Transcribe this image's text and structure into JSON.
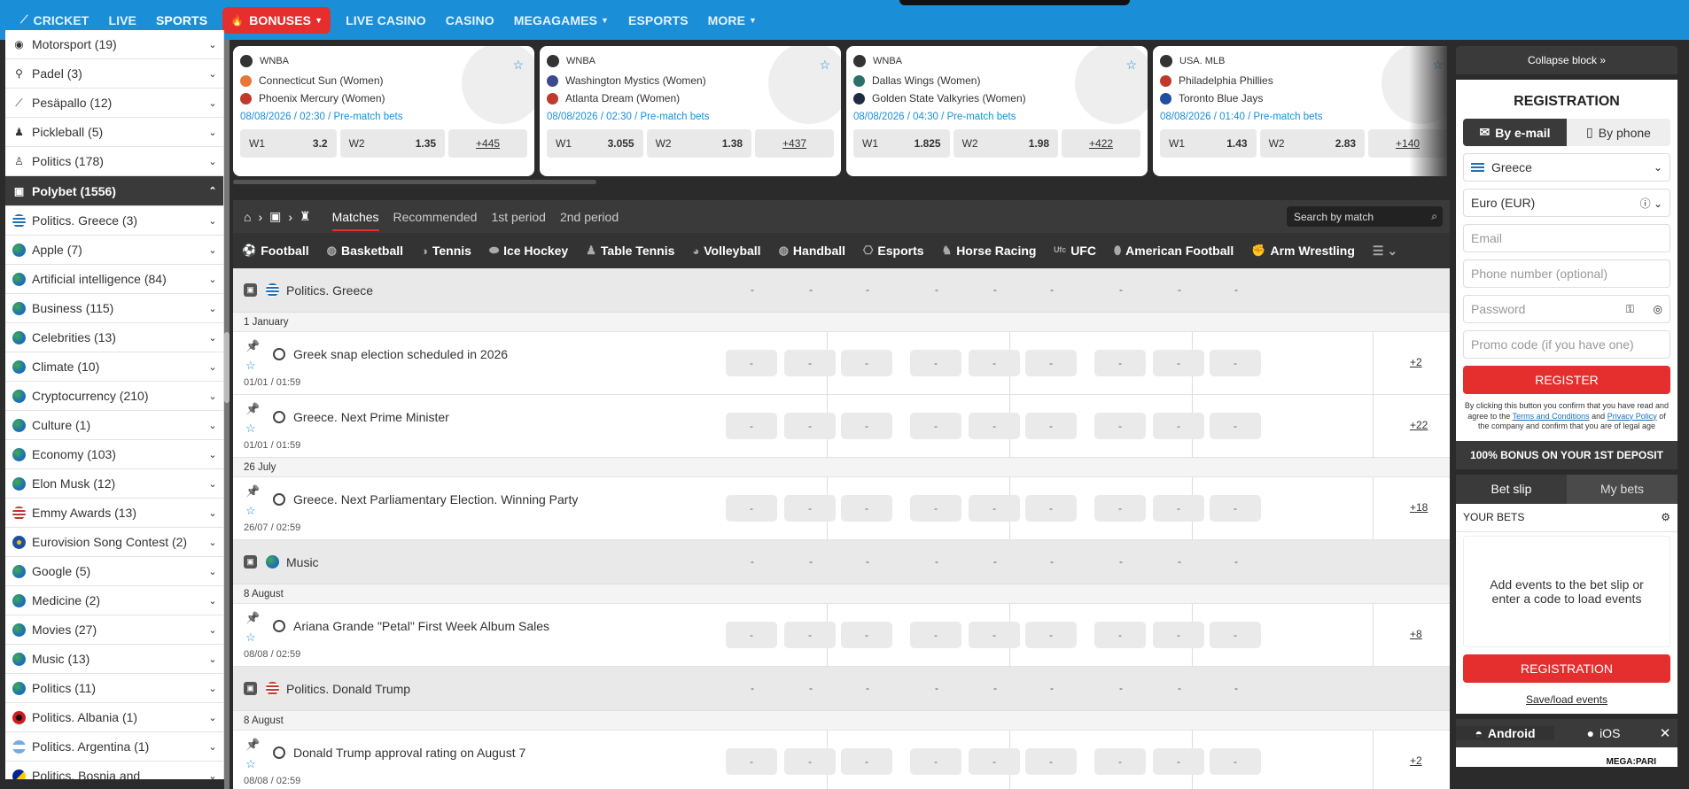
{
  "nav": {
    "items": [
      {
        "label": "CRICKET",
        "icon": "cricket-bat-icon"
      },
      {
        "label": "LIVE"
      },
      {
        "label": "SPORTS",
        "active": true
      },
      {
        "label": "BONUSES",
        "icon": "fire-icon",
        "dropdown": true,
        "style": "bonus"
      },
      {
        "label": "LIVE CASINO"
      },
      {
        "label": "CASINO"
      },
      {
        "label": "MEGAGAMES",
        "dropdown": true
      },
      {
        "label": "ESPORTS"
      },
      {
        "label": "MORE",
        "dropdown": true
      }
    ],
    "brand_color": "#1a8fd8"
  },
  "sidebar": {
    "items": [
      {
        "label": "Motorsport (19)",
        "icon": "motorsport-icon"
      },
      {
        "label": "Padel (3)",
        "icon": "padel-icon"
      },
      {
        "label": "Pesäpallo (12)",
        "icon": "pesapallo-icon"
      },
      {
        "label": "Pickleball (5)",
        "icon": "pickleball-icon"
      },
      {
        "label": "Politics (178)",
        "icon": "politics-icon"
      },
      {
        "label": "Polybet (1556)",
        "icon": "polybet-icon",
        "header": true
      },
      {
        "label": "Politics. Greece (3)",
        "icon": "greece-flag-icon"
      },
      {
        "label": "Apple (7)",
        "icon": "globe-icon"
      },
      {
        "label": "Artificial intelligence (84)",
        "icon": "globe-icon"
      },
      {
        "label": "Business (115)",
        "icon": "globe-icon"
      },
      {
        "label": "Celebrities (13)",
        "icon": "globe-icon"
      },
      {
        "label": "Climate (10)",
        "icon": "globe-icon"
      },
      {
        "label": "Cryptocurrency (210)",
        "icon": "globe-icon"
      },
      {
        "label": "Culture (1)",
        "icon": "globe-icon"
      },
      {
        "label": "Economy (103)",
        "icon": "globe-icon"
      },
      {
        "label": "Elon Musk (12)",
        "icon": "globe-icon"
      },
      {
        "label": "Emmy Awards (13)",
        "icon": "usa-flag-icon"
      },
      {
        "label": "Eurovision Song Contest (2)",
        "icon": "eu-flag-icon"
      },
      {
        "label": "Google (5)",
        "icon": "globe-icon"
      },
      {
        "label": "Medicine (2)",
        "icon": "globe-icon"
      },
      {
        "label": "Movies (27)",
        "icon": "globe-icon"
      },
      {
        "label": "Music (13)",
        "icon": "globe-icon"
      },
      {
        "label": "Politics (11)",
        "icon": "globe-icon"
      },
      {
        "label": "Politics. Albania (1)",
        "icon": "albania-flag-icon"
      },
      {
        "label": "Politics. Argentina (1)",
        "icon": "argentina-flag-icon"
      },
      {
        "label": "Politics. Bosnia and",
        "icon": "bosnia-flag-icon"
      }
    ]
  },
  "cards": [
    {
      "league": "WNBA",
      "team1": "Connecticut Sun (Women)",
      "team2": "Phoenix Mercury (Women)",
      "date": "08/08/2026 / 02:30 / Pre-match bets",
      "w1_label": "W1",
      "w1": "3.2",
      "w2_label": "W2",
      "w2": "1.35",
      "more": "+445",
      "t1color": "#e8763a",
      "t2color": "#c0392b"
    },
    {
      "league": "WNBA",
      "team1": "Washington Mystics (Women)",
      "team2": "Atlanta Dream (Women)",
      "date": "08/08/2026 / 02:30 / Pre-match bets",
      "w1_label": "W1",
      "w1": "3.055",
      "w2_label": "W2",
      "w2": "1.38",
      "more": "+437",
      "t1color": "#3b4a8c",
      "t2color": "#c0392b"
    },
    {
      "league": "WNBA",
      "team1": "Dallas Wings (Women)",
      "team2": "Golden State Valkyries (Women)",
      "date": "08/08/2026 / 04:30 / Pre-match bets",
      "w1_label": "W1",
      "w1": "1.825",
      "w2_label": "W2",
      "w2": "1.98",
      "more": "+422",
      "t1color": "#2c6f6a",
      "t2color": "#1f2a44"
    },
    {
      "league": "USA. MLB",
      "team1": "Philadelphia Phillies",
      "team2": "Toronto Blue Jays",
      "date": "08/08/2026 / 01:40 / Pre-match bets",
      "w1_label": "W1",
      "w1": "1.43",
      "w2_label": "W2",
      "w2": "2.83",
      "more": "+140",
      "t1color": "#c0392b",
      "t2color": "#1f4fa0"
    }
  ],
  "crumbs": {
    "tabs": [
      "Matches",
      "Recommended",
      "1st period",
      "2nd period"
    ],
    "search_placeholder": "Search by match"
  },
  "sports_bar": [
    {
      "label": "Football",
      "icon": "football-icon"
    },
    {
      "label": "Basketball",
      "icon": "basketball-icon"
    },
    {
      "label": "Tennis",
      "icon": "tennis-icon"
    },
    {
      "label": "Ice Hockey",
      "icon": "ice-hockey-icon"
    },
    {
      "label": "Table Tennis",
      "icon": "table-tennis-icon"
    },
    {
      "label": "Volleyball",
      "icon": "volleyball-icon"
    },
    {
      "label": "Handball",
      "icon": "handball-icon"
    },
    {
      "label": "Esports",
      "icon": "gamepad-icon"
    },
    {
      "label": "Horse Racing",
      "icon": "horse-icon"
    },
    {
      "label": "UFC",
      "icon": "ufc-icon"
    },
    {
      "label": "American Football",
      "icon": "american-football-icon"
    },
    {
      "label": "Arm Wrestling",
      "icon": "arm-wrestling-icon"
    }
  ],
  "groups": [
    {
      "title": "Politics. Greece",
      "flag": "greece",
      "placeholder": "-",
      "days": [
        {
          "date": "1 January",
          "events": [
            {
              "name": "Greek snap election scheduled in 2026",
              "time": "01/01 / 01:59",
              "more": "+2"
            },
            {
              "name": "Greece. Next Prime Minister",
              "time": "01/01 / 01:59",
              "more": "+22"
            }
          ]
        },
        {
          "date": "26 July",
          "events": [
            {
              "name": "Greece. Next Parliamentary Election. Winning Party",
              "time": "26/07 / 02:59",
              "more": "+18"
            }
          ]
        }
      ]
    },
    {
      "title": "Music",
      "flag": "globe",
      "placeholder": "-",
      "days": [
        {
          "date": "8 August",
          "events": [
            {
              "name": "Ariana Grande \"Petal\" First Week Album Sales",
              "time": "08/08 / 02:59",
              "more": "+8"
            }
          ]
        }
      ]
    },
    {
      "title": "Politics. Donald Trump",
      "flag": "usa",
      "placeholder": "-",
      "days": [
        {
          "date": "8 August",
          "events": [
            {
              "name": "Donald Trump approval rating on August 7",
              "time": "08/08 / 02:59",
              "more": "+2"
            }
          ]
        }
      ]
    }
  ],
  "right": {
    "collapse": "Collapse block",
    "reg_title": "REGISTRATION",
    "tab_email": "By e-mail",
    "tab_phone": "By phone",
    "country": "Greece",
    "currency": "Euro (EUR)",
    "email_ph": "Email",
    "phone_ph": "Phone number (optional)",
    "password_ph": "Password",
    "promo_ph": "Promo code (if you have one)",
    "register": "REGISTER",
    "disc_1": "By clicking this button you confirm that you have read and agree to the",
    "terms": "Terms and Conditions",
    "disc_and": "and",
    "privacy": "Privacy Policy",
    "disc_2": "of the company and confirm that you are of legal age",
    "bonus": "100% BONUS ON YOUR 1ST DEPOSIT",
    "betslip": "Bet slip",
    "mybets": "My bets",
    "your_bets": "YOUR BETS",
    "empty": "Add events to the bet slip or enter a code to load events",
    "registration": "REGISTRATION",
    "save": "Save/load events",
    "android": "Android",
    "ios": "iOS",
    "promo_logo": "MEGA:PARI"
  },
  "colors": {
    "accent_red": "#e52e2e",
    "link_blue": "#1a8fd8",
    "dark": "#3a3a3a"
  }
}
